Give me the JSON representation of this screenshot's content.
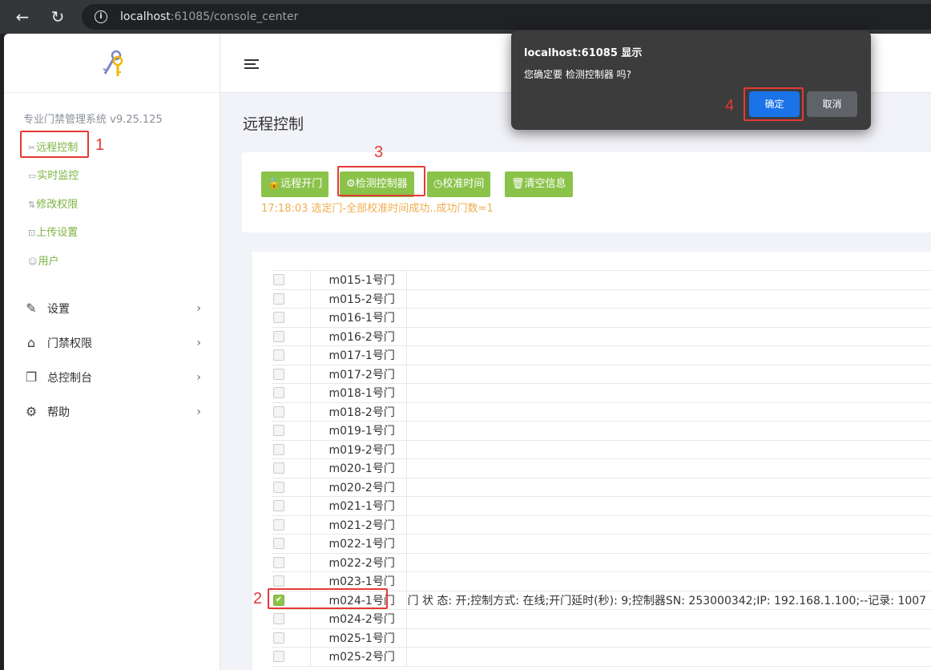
{
  "browser": {
    "url_host": "localhost",
    "url_rest": ":61085/console_center"
  },
  "sidebar": {
    "system_title": "专业门禁管理系统 v9.25.125",
    "sub_items": [
      {
        "icon": "✂",
        "label": "远程控制"
      },
      {
        "icon": "▭",
        "label": "实时监控"
      },
      {
        "icon": "⇅",
        "label": "修改权限"
      },
      {
        "icon": "⊡",
        "label": "上传设置"
      },
      {
        "icon": "☺",
        "label": "用户"
      }
    ],
    "menu": [
      {
        "icon": "✎",
        "label": "设置"
      },
      {
        "icon": "⌂",
        "label": "门禁权限"
      },
      {
        "icon": "❐",
        "label": "总控制台"
      },
      {
        "icon": "⚙",
        "label": "帮助"
      }
    ]
  },
  "main": {
    "page_title": "远程控制",
    "buttons": [
      {
        "icon": "🔓",
        "label": "远程开门"
      },
      {
        "icon": "⚙",
        "label": "检测控制器"
      },
      {
        "icon": "◷",
        "label": "校准时间"
      },
      {
        "icon": "🗑",
        "label": "清空信息"
      }
    ],
    "status_line": "17:18:03 选定门-全部校准时间成功..成功门数=1",
    "doors": [
      {
        "name": "m015-1号门",
        "checked": false,
        "info": ""
      },
      {
        "name": "m015-2号门",
        "checked": false,
        "info": ""
      },
      {
        "name": "m016-1号门",
        "checked": false,
        "info": ""
      },
      {
        "name": "m016-2号门",
        "checked": false,
        "info": ""
      },
      {
        "name": "m017-1号门",
        "checked": false,
        "info": ""
      },
      {
        "name": "m017-2号门",
        "checked": false,
        "info": ""
      },
      {
        "name": "m018-1号门",
        "checked": false,
        "info": ""
      },
      {
        "name": "m018-2号门",
        "checked": false,
        "info": ""
      },
      {
        "name": "m019-1号门",
        "checked": false,
        "info": ""
      },
      {
        "name": "m019-2号门",
        "checked": false,
        "info": ""
      },
      {
        "name": "m020-1号门",
        "checked": false,
        "info": ""
      },
      {
        "name": "m020-2号门",
        "checked": false,
        "info": ""
      },
      {
        "name": "m021-1号门",
        "checked": false,
        "info": ""
      },
      {
        "name": "m021-2号门",
        "checked": false,
        "info": ""
      },
      {
        "name": "m022-1号门",
        "checked": false,
        "info": ""
      },
      {
        "name": "m022-2号门",
        "checked": false,
        "info": ""
      },
      {
        "name": "m023-1号门",
        "checked": false,
        "info": ""
      },
      {
        "name": "m024-1号门",
        "checked": true,
        "info": "门 状 态: 开;控制方式: 在线;开门延时(秒): 9;控制器SN: 253000342;IP: 192.168.1.100;--记录: 1007"
      },
      {
        "name": "m024-2号门",
        "checked": false,
        "info": ""
      },
      {
        "name": "m025-1号门",
        "checked": false,
        "info": ""
      },
      {
        "name": "m025-2号门",
        "checked": false,
        "info": ""
      }
    ]
  },
  "dialog": {
    "title": "localhost:61085 显示",
    "message": "您确定要 检测控制器 吗?",
    "ok_label": "确定",
    "cancel_label": "取消"
  },
  "annotations": [
    "1",
    "2",
    "3",
    "4"
  ]
}
